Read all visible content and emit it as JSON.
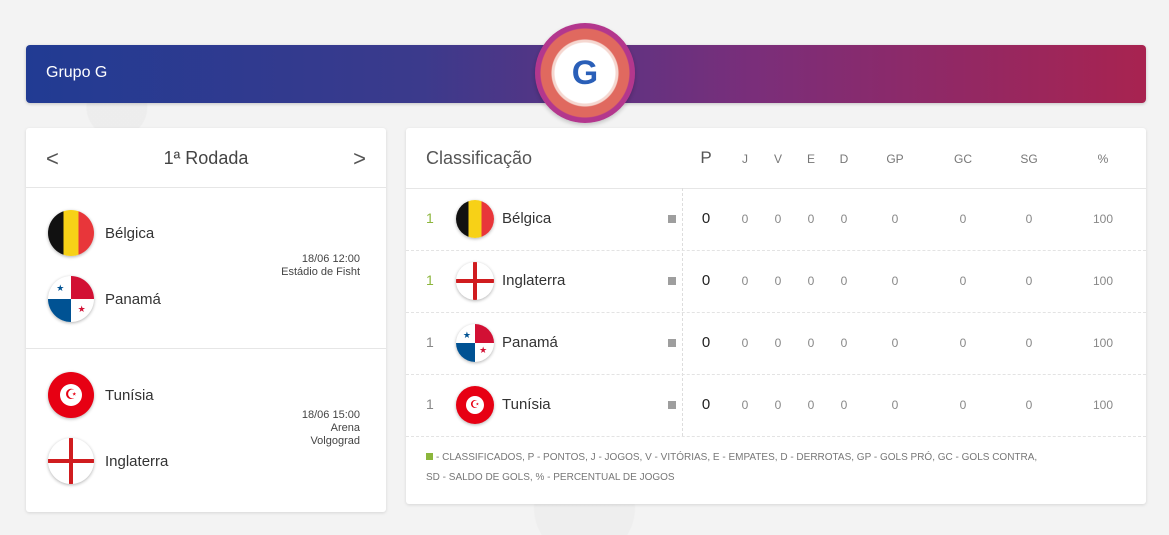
{
  "banner": {
    "title": "Grupo G",
    "group_letter": "G"
  },
  "matches": {
    "round_title": "1ª Rodada",
    "prev_icon": "chevron-left-icon",
    "next_icon": "chevron-right-icon",
    "items": [
      {
        "home": "Bélgica",
        "away": "Panamá",
        "datetime": "18/06 12:00",
        "venue": "Estádio de Fisht"
      },
      {
        "home": "Tunísia",
        "away": "Inglaterra",
        "datetime": "18/06 15:00",
        "venue_line1": "Arena",
        "venue_line2": "Volgograd"
      }
    ]
  },
  "standings": {
    "title": "Classificação",
    "columns": [
      "P",
      "J",
      "V",
      "E",
      "D",
      "GP",
      "GC",
      "SG",
      "%"
    ],
    "rows": [
      {
        "pos": "1",
        "team": "Bélgica",
        "qualified": true,
        "P": "0",
        "J": "0",
        "V": "0",
        "E": "0",
        "D": "0",
        "GP": "0",
        "GC": "0",
        "SG": "0",
        "pct": "100"
      },
      {
        "pos": "1",
        "team": "Inglaterra",
        "qualified": true,
        "P": "0",
        "J": "0",
        "V": "0",
        "E": "0",
        "D": "0",
        "GP": "0",
        "GC": "0",
        "SG": "0",
        "pct": "100"
      },
      {
        "pos": "1",
        "team": "Panamá",
        "qualified": false,
        "P": "0",
        "J": "0",
        "V": "0",
        "E": "0",
        "D": "0",
        "GP": "0",
        "GC": "0",
        "SG": "0",
        "pct": "100"
      },
      {
        "pos": "1",
        "team": "Tunísia",
        "qualified": false,
        "P": "0",
        "J": "0",
        "V": "0",
        "E": "0",
        "D": "0",
        "GP": "0",
        "GC": "0",
        "SG": "0",
        "pct": "100"
      }
    ],
    "legend_line1": "- CLASSIFICADOS,   P - PONTOS,   J - JOGOS,   V - VITÓRIAS,   E - EMPATES,   D - DERROTAS,   GP - GOLS PRÓ,   GC - GOLS CONTRA,",
    "legend_line2": "SD - SALDO DE GOLS,   % - PERCENTUAL DE JOGOS"
  },
  "colors": {
    "qualified": "#8cb63c",
    "banner_start": "#213b93",
    "banner_end": "#a82350"
  }
}
